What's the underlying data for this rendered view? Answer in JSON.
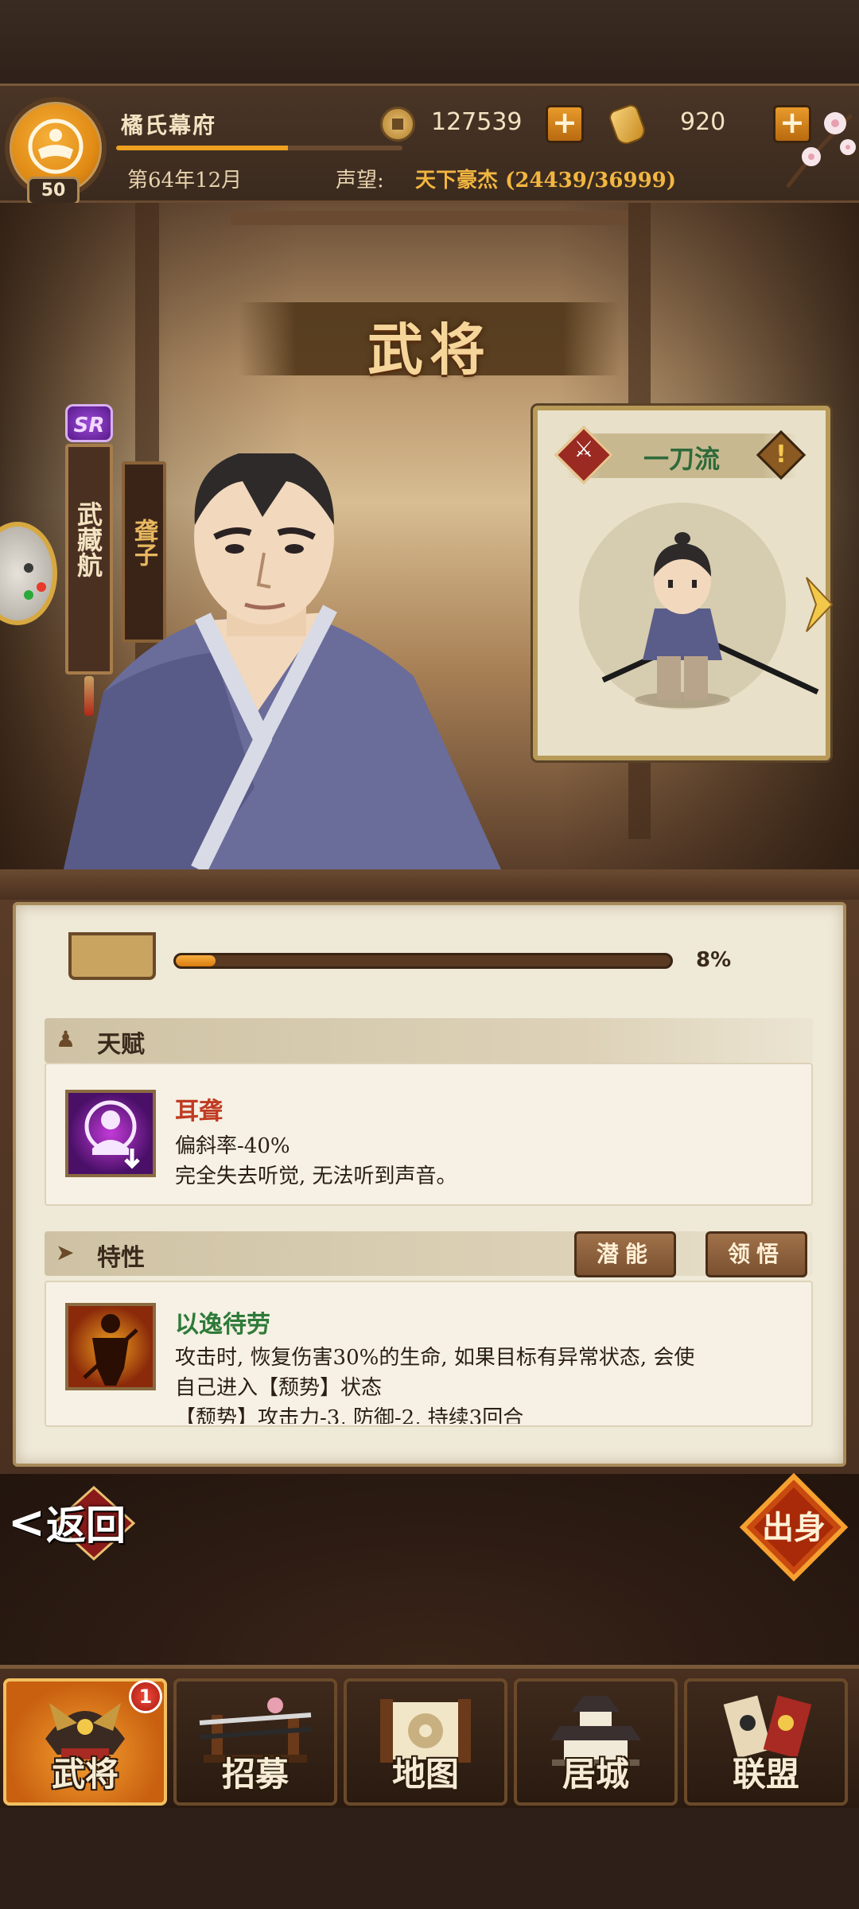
{
  "header": {
    "clan_name": "橘氏幕府",
    "level": "50",
    "copper": "127539",
    "gold": "920",
    "date": "第64年12月",
    "fame_label": "声望:",
    "fame_value": "天下豪杰 (24439/36999)"
  },
  "page": {
    "title": "武将"
  },
  "hero": {
    "rarity": "SR",
    "name": "武藏航",
    "trait_tag": "聋子"
  },
  "job": {
    "name": "一刀流",
    "info_symbol": "!"
  },
  "progress": {
    "fill": 0.08,
    "text": "8%"
  },
  "talent": {
    "section_title": "天赋",
    "name": "耳聋",
    "line1": "偏斜率-40%",
    "line2": "完全失去听觉, 无法听到声音。"
  },
  "traits": {
    "section_title": "特性",
    "potential_button": "潜能",
    "insight_button": "领悟",
    "name": "以逸待劳",
    "line1": "攻击时, 恢复伤害30%的生命, 如果目标有异常状态, 会使",
    "line2": "自己进入【颓势】状态",
    "line3": "【颓势】攻击力-3, 防御-2, 持续3回合"
  },
  "actions": {
    "back": "返回",
    "enlist": "出身"
  },
  "nav": {
    "items": [
      {
        "label": "武将",
        "icon": "samurai-helmet-icon"
      },
      {
        "label": "招募",
        "icon": "katana-stand-icon"
      },
      {
        "label": "地图",
        "icon": "scroll-map-icon"
      },
      {
        "label": "居城",
        "icon": "castle-icon"
      },
      {
        "label": "联盟",
        "icon": "alliance-banner-icon"
      }
    ],
    "badge": "1"
  },
  "colors": {
    "accent": "#e08a14",
    "talent_name": "#c03a22",
    "trait_name": "#2f7a3a",
    "fame": "#f2b640"
  }
}
